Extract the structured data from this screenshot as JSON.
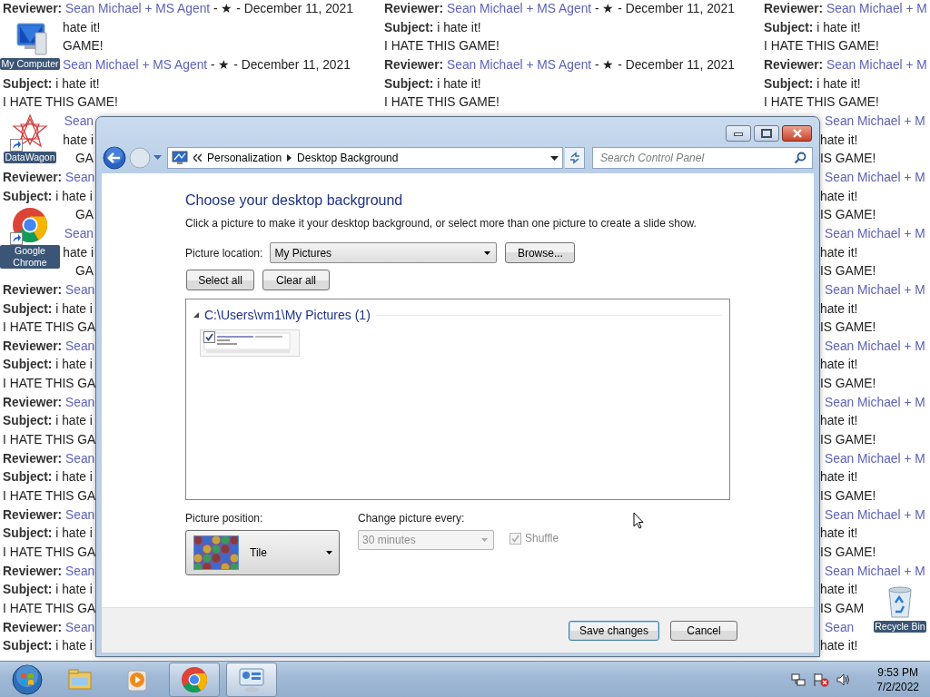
{
  "desktop": {
    "wallpaper": {
      "lines": [
        {
          "segments": [
            {
              "kind": "reviewer",
              "label": "Reviewer:",
              "text": "Sean Michael + MS Agent",
              "rest": "- ★ - December 11, 2021"
            },
            {
              "kind": "reviewer",
              "label": "Reviewer:",
              "text": "Sean Michael + MS Agent",
              "rest": "- ★ - December 11, 2021"
            },
            {
              "kind": "reviewer",
              "label": "Reviewer:",
              "text": "Sean Michael + M"
            }
          ]
        },
        {
          "segments": [
            {
              "kind": "plain",
              "text": "hate it!"
            },
            {
              "kind": "subject",
              "label": "Subject:",
              "text": "i hate it!"
            },
            {
              "kind": "subject",
              "label": "Subject:",
              "text": "i hate it!"
            }
          ]
        },
        {
          "segments": [
            {
              "kind": "plain",
              "text": "GAME!"
            },
            {
              "kind": "plain",
              "text": "I HATE THIS GAME!"
            },
            {
              "kind": "plain",
              "text": "I HATE THIS GAME!"
            }
          ]
        },
        {
          "segments": [
            {
              "kind": "reviewer",
              "text": "Sean Michael + MS Agent",
              "rest": "- ★ - December 11, 2021"
            },
            {
              "kind": "reviewer",
              "label": "Reviewer:",
              "text": "Sean Michael + MS Agent",
              "rest": "- ★ - December 11, 2021"
            },
            {
              "kind": "reviewer",
              "label": "Reviewer:",
              "text": "Sean Michael + M"
            }
          ]
        },
        {
          "segments": [
            {
              "kind": "subject",
              "label": "Subject:",
              "text": "i hate it!"
            },
            {
              "kind": "subject",
              "label": "Subject:",
              "text": "i hate it!"
            },
            {
              "kind": "subject",
              "label": "Subject:",
              "text": "i hate it!"
            }
          ]
        },
        {
          "segments": [
            {
              "kind": "plain",
              "text": "I HATE THIS GAME!"
            },
            {
              "kind": "plain",
              "text": "I HATE THIS GAME!"
            },
            {
              "kind": "plain",
              "text": "I HATE THIS GAME!"
            }
          ]
        },
        {
          "segments": [
            {
              "kind": "link",
              "text": "Sean"
            },
            {
              "kind": "link",
              "text": "Sean Michael + M"
            }
          ]
        },
        {
          "segments": [
            {
              "kind": "plain",
              "text": "hate i"
            },
            {
              "kind": "plain",
              "text": "hate it!"
            }
          ]
        },
        {
          "segments": [
            {
              "kind": "plain",
              "text": "GA"
            },
            {
              "kind": "plain",
              "text": "IS GAME!"
            }
          ]
        },
        {
          "segments": [
            {
              "kind": "reviewer",
              "label": "Reviewer:",
              "text": "Sean"
            },
            {
              "kind": "link",
              "text": "Sean Michael + M"
            }
          ]
        },
        {
          "segments": [
            {
              "kind": "subject",
              "label": "Subject:",
              "text": "i hate i"
            },
            {
              "kind": "plain",
              "text": "hate it!"
            }
          ]
        },
        {
          "segments": [
            {
              "kind": "plain",
              "text": "GA"
            },
            {
              "kind": "plain",
              "text": "IS GAME!"
            }
          ]
        },
        {
          "segments": [
            {
              "kind": "link",
              "text": "Sean"
            },
            {
              "kind": "link",
              "text": "Sean Michael + M"
            }
          ]
        },
        {
          "segments": [
            {
              "kind": "plain",
              "text": "hate i"
            },
            {
              "kind": "plain",
              "text": "hate it!"
            }
          ]
        },
        {
          "segments": [
            {
              "kind": "plain",
              "text": "GA"
            },
            {
              "kind": "plain",
              "text": "IS GAME!"
            }
          ]
        },
        {
          "segments": [
            {
              "kind": "reviewer",
              "label": "Reviewer:",
              "text": "Sean"
            },
            {
              "kind": "link",
              "text": "Sean Michael + M"
            }
          ]
        },
        {
          "segments": [
            {
              "kind": "subject",
              "label": "Subject:",
              "text": "i hate i"
            },
            {
              "kind": "plain",
              "text": "hate it!"
            }
          ]
        },
        {
          "segments": [
            {
              "kind": "plain",
              "text": "I HATE THIS GA"
            },
            {
              "kind": "plain",
              "text": "IS GAME!"
            }
          ]
        },
        {
          "segments": [
            {
              "kind": "reviewer",
              "label": "Reviewer:",
              "text": "Sean"
            },
            {
              "kind": "link",
              "text": "Sean Michael + M"
            }
          ]
        },
        {
          "segments": [
            {
              "kind": "subject",
              "label": "Subject:",
              "text": "i hate i"
            },
            {
              "kind": "plain",
              "text": "hate it!"
            }
          ]
        },
        {
          "segments": [
            {
              "kind": "plain",
              "text": "I HATE THIS GA"
            },
            {
              "kind": "plain",
              "text": "IS GAME!"
            }
          ]
        },
        {
          "segments": [
            {
              "kind": "reviewer",
              "label": "Reviewer:",
              "text": "Sean"
            },
            {
              "kind": "link",
              "text": "Sean Michael + M"
            }
          ]
        },
        {
          "segments": [
            {
              "kind": "subject",
              "label": "Subject:",
              "text": "i hate i"
            },
            {
              "kind": "plain",
              "text": "hate it!"
            }
          ]
        },
        {
          "segments": [
            {
              "kind": "plain",
              "text": "I HATE THIS GA"
            },
            {
              "kind": "plain",
              "text": "IS GAME!"
            }
          ]
        },
        {
          "segments": [
            {
              "kind": "reviewer",
              "label": "Reviewer:",
              "text": "Sean"
            },
            {
              "kind": "link",
              "text": "Sean Michael + M"
            }
          ]
        },
        {
          "segments": [
            {
              "kind": "subject",
              "label": "Subject:",
              "text": "i hate i"
            },
            {
              "kind": "plain",
              "text": "hate it!"
            }
          ]
        },
        {
          "segments": [
            {
              "kind": "plain",
              "text": "I HATE THIS GA"
            },
            {
              "kind": "plain",
              "text": "IS GAME!"
            }
          ]
        },
        {
          "segments": [
            {
              "kind": "reviewer",
              "label": "Reviewer:",
              "text": "Sean"
            },
            {
              "kind": "link",
              "text": "Sean Michael + M"
            }
          ]
        },
        {
          "segments": [
            {
              "kind": "subject",
              "label": "Subject:",
              "text": "i hate i"
            },
            {
              "kind": "plain",
              "text": "hate it!"
            }
          ]
        },
        {
          "segments": [
            {
              "kind": "plain",
              "text": "I HATE THIS GA"
            },
            {
              "kind": "plain",
              "text": "IS GAME!"
            }
          ]
        },
        {
          "segments": [
            {
              "kind": "reviewer",
              "label": "Reviewer:",
              "text": "Sean"
            },
            {
              "kind": "link",
              "text": "Sean Michael + M"
            }
          ]
        },
        {
          "segments": [
            {
              "kind": "subject",
              "label": "Subject:",
              "text": "i hate i"
            },
            {
              "kind": "plain",
              "text": "hate it!"
            }
          ]
        },
        {
          "segments": [
            {
              "kind": "plain",
              "text": "I HATE THIS GA"
            },
            {
              "kind": "plain",
              "text": "IS GAM"
            }
          ]
        },
        {
          "segments": [
            {
              "kind": "reviewer",
              "label": "Reviewer:",
              "text": "Sean"
            },
            {
              "kind": "link",
              "text": "Sean"
            }
          ]
        },
        {
          "segments": [
            {
              "kind": "subject",
              "label": "Subject:",
              "text": "i hate i"
            },
            {
              "kind": "plain",
              "text": "hate it!"
            }
          ]
        }
      ]
    },
    "icons": [
      {
        "kind": "computer",
        "label": "My Computer",
        "shortcut": false
      },
      {
        "kind": "datawagon",
        "label": "DataWagon",
        "shortcut": true
      },
      {
        "kind": "chrome",
        "label": "Google Chrome",
        "shortcut": true
      },
      {
        "kind": "recycle",
        "label": "Recycle Bin",
        "shortcut": false
      }
    ]
  },
  "window": {
    "breadcrumb": [
      "Personalization",
      "Desktop Background"
    ],
    "search": {
      "placeholder": "Search Control Panel"
    },
    "heading": "Choose your desktop background",
    "description": "Click a picture to make it your desktop background, or select more than one picture to create a slide show.",
    "picture_location": {
      "label": "Picture location:",
      "value": "My Pictures"
    },
    "browse_button": "Browse...",
    "select_buttons": [
      "Select all",
      "Clear all"
    ],
    "group": {
      "title": "C:\\Users\\vm1\\My Pictures (1)",
      "expanded": true,
      "items": [
        {
          "kind": "picture",
          "checked": true
        }
      ]
    },
    "picture_position": {
      "label": "Picture position:",
      "value": "Tile"
    },
    "change_interval": {
      "label": "Change picture every:",
      "value": "30 minutes",
      "disabled": true
    },
    "shuffle": {
      "label": "Shuffle",
      "checked": true,
      "disabled": true
    },
    "footer_buttons": [
      {
        "label": "Save changes",
        "default": true
      },
      {
        "label": "Cancel",
        "default": false
      }
    ]
  },
  "taskbar": {
    "apps": [
      {
        "kind": "explorer",
        "open": false,
        "selected": false
      },
      {
        "kind": "media",
        "open": false,
        "selected": false
      },
      {
        "kind": "chrome",
        "open": true,
        "selected": false
      },
      {
        "kind": "control",
        "open": true,
        "selected": true
      }
    ],
    "clock": {
      "time": "9:53 PM",
      "date": "7/2/2022"
    }
  }
}
